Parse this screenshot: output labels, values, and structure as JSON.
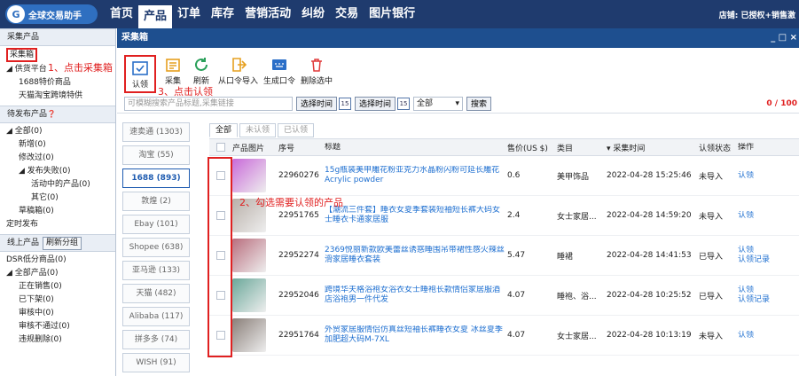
{
  "topbar": {
    "logo_text": "全球交易助手",
    "nav": [
      "首页",
      "产品",
      "订单",
      "库存",
      "营销活动",
      "纠纷",
      "交易",
      "图片银行"
    ],
    "active_nav": "产品",
    "store_text": "店铺: 已授权+销售激"
  },
  "sidebar": {
    "sections": [
      {
        "head": "采集产品",
        "items": [
          {
            "label": "采集箱",
            "indent": 1,
            "boxed": true
          },
          {
            "label": "◢ 供货平台",
            "indent": 1
          },
          {
            "label": "1688特价商品",
            "indent": 3
          },
          {
            "label": "天猫淘宝跨境特供",
            "indent": 3
          }
        ]
      },
      {
        "head": "待发布产品",
        "items": [
          {
            "label": "◢ 全部(0)",
            "indent": 1
          },
          {
            "label": "新增(0)",
            "indent": 3
          },
          {
            "label": "修改过(0)",
            "indent": 3
          },
          {
            "label": "◢ 发布失败(0)",
            "indent": 3
          },
          {
            "label": "活动中的产品(0)",
            "indent": 5
          },
          {
            "label": "其它(0)",
            "indent": 5
          },
          {
            "label": "草稿箱(0)",
            "indent": 3
          },
          {
            "label": "定时发布",
            "indent": 1
          }
        ]
      },
      {
        "head": "线上产品",
        "items": [
          {
            "label": "DSR低分商品(0)",
            "indent": 1
          },
          {
            "label": "◢ 全部产品(0)",
            "indent": 1
          },
          {
            "label": "正在销售(0)",
            "indent": 3
          },
          {
            "label": "已下架(0)",
            "indent": 3
          },
          {
            "label": "审核中(0)",
            "indent": 3
          },
          {
            "label": "审核不通过(0)",
            "indent": 3
          },
          {
            "label": "违规删除(0)",
            "indent": 3
          }
        ]
      }
    ],
    "refresh_group_label": "刷新分组",
    "help_icon": "help-icon"
  },
  "annotations": {
    "step1": "1、点击采集箱",
    "step2": "2、勾选需要认领的产品",
    "step3": "3、点击认领"
  },
  "window": {
    "title": "采集箱",
    "controls": "_ □ ×"
  },
  "toolbar": {
    "buttons": [
      {
        "label": "认领",
        "icon": "claim-icon"
      },
      {
        "label": "采集",
        "icon": "collect-icon"
      },
      {
        "label": "刷新",
        "icon": "refresh-icon"
      },
      {
        "label": "从口令导入",
        "icon": "import-icon"
      },
      {
        "label": "生成口令",
        "icon": "command-icon"
      },
      {
        "label": "删除选中",
        "icon": "trash-icon"
      }
    ]
  },
  "search": {
    "placeholder": "可模糊搜索产品标题,采集链接",
    "time1_label": "选择时间",
    "time2_label": "选择时间",
    "cal_day": "15",
    "select_value": "全部",
    "search_label": "搜索",
    "count": "0 / 100"
  },
  "platforms": [
    "速卖通 (1303)",
    "淘宝 (55)",
    "1688 (893)",
    "敦煌 (2)",
    "Ebay (101)",
    "Shopee (638)",
    "亚马逊 (133)",
    "天猫 (482)",
    "Alibaba (117)",
    "拼多多 (74)",
    "WISH (91)"
  ],
  "active_platform": "1688 (893)",
  "tabs": [
    "全部",
    "未认领",
    "已认领"
  ],
  "active_tab": "全部",
  "table": {
    "headers": [
      "产品图片",
      "序号",
      "标题",
      "售价(US $)",
      "类目",
      "▾ 采集时间",
      "认领状态",
      "操作"
    ],
    "rows": [
      {
        "no": "22960276",
        "title": "15g瓶装美甲雕花粉亚克力水晶粉闪粉可延长雕花Acrylic powder",
        "price": "0.6",
        "category": "美甲饰品",
        "time": "2022-04-28 15:25:46",
        "status": "未导入",
        "ops": [
          "认领"
        ],
        "thumb": "#c96ad9"
      },
      {
        "no": "22951765",
        "title": "【潮流三件套】睡衣女夏季套装短袖短长裤大码女士睡衣卡通家居服",
        "price": "2.4",
        "category": "女士家居...",
        "time": "2022-04-28 14:59:20",
        "status": "未导入",
        "ops": [
          "认领"
        ],
        "thumb": "#b9b0a9"
      },
      {
        "no": "22952274",
        "title": "2369悦丽新款欧美蕾丝诱惑睡围吊带裙性感火辣丝滑家居睡衣套装",
        "price": "5.47",
        "category": "睡裙",
        "time": "2022-04-28 14:41:53",
        "status": "已导入",
        "ops": [
          "认领",
          "认领记录"
        ],
        "thumb": "#b96e7e"
      },
      {
        "no": "22952046",
        "title": "跨境华夫格浴袍女浴衣女士睡袍长款情侣家居服酒店浴袍男一件代发",
        "price": "4.07",
        "category": "睡袍、浴...",
        "time": "2022-04-28 10:25:52",
        "status": "已导入",
        "ops": [
          "认领",
          "认领记录"
        ],
        "thumb": "#6ba89a"
      },
      {
        "no": "22951764",
        "title": "外贸家居服情侣仿真丝短袖长裤睡衣女夏 冰丝夏季加肥超大码M-7XL",
        "price": "4.07",
        "category": "女士家居...",
        "time": "2022-04-28 10:13:19",
        "status": "未导入",
        "ops": [
          "认领"
        ],
        "thumb": "#8a7f79"
      }
    ]
  }
}
